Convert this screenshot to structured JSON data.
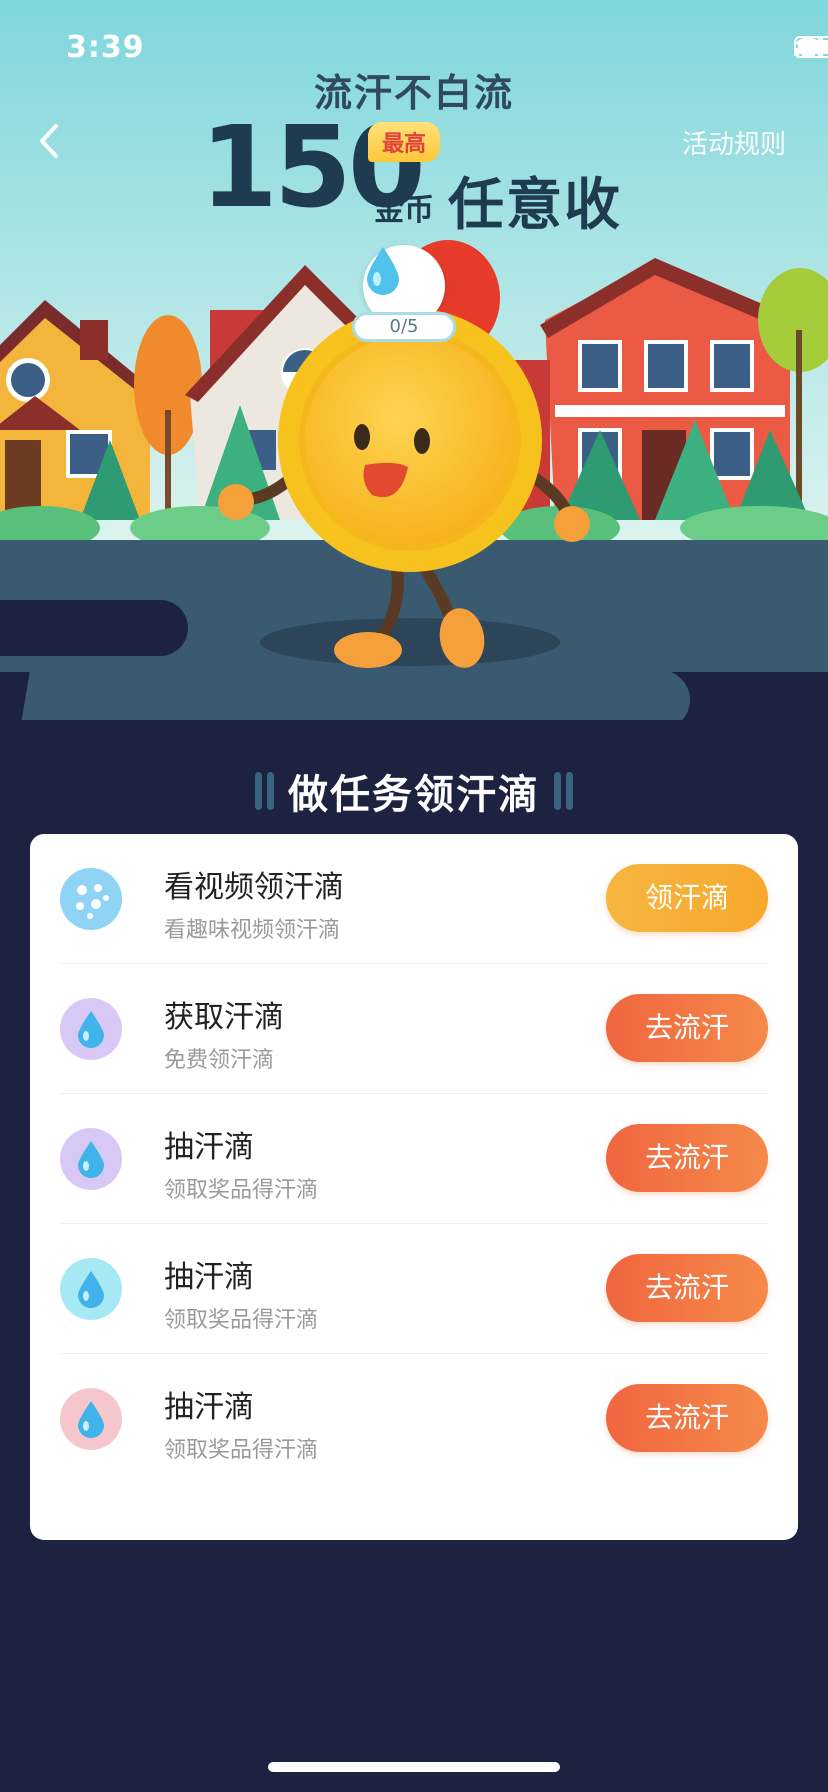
{
  "status_bar": {
    "time": "3:39"
  },
  "header": {
    "back_label": "‹",
    "rules_link": "活动规则",
    "headline_top": "流汗不白流",
    "big_number": "150",
    "badge_max": "最高",
    "unit": "金币",
    "tagline": "任意收"
  },
  "drop_meter": {
    "progress_text": "0/5",
    "collected": 0,
    "total": 5
  },
  "section": {
    "title": "做任务领汗滴"
  },
  "tasks": [
    {
      "icon": "video-dots-icon",
      "icon_bg": "#8fd3f5",
      "title": "看视频领汗滴",
      "subtitle": "看趣味视频领汗滴",
      "button": "领汗滴",
      "button_style": "yellow"
    },
    {
      "icon": "water-drop-icon",
      "icon_bg": "#d7c8f5",
      "title": "获取汗滴",
      "subtitle": "免费领汗滴",
      "button": "去流汗",
      "button_style": "orange"
    },
    {
      "icon": "water-drop-icon",
      "icon_bg": "#d7c8f5",
      "title": "抽汗滴",
      "subtitle": "领取奖品得汗滴",
      "button": "去流汗",
      "button_style": "orange"
    },
    {
      "icon": "water-drop-icon",
      "icon_bg": "#a7e8f5",
      "title": "抽汗滴",
      "subtitle": "领取奖品得汗滴",
      "button": "去流汗",
      "button_style": "orange"
    },
    {
      "icon": "water-drop-icon",
      "icon_bg": "#f5c7cc",
      "title": "抽汗滴",
      "subtitle": "领取奖品得汗滴",
      "button": "去流汗",
      "button_style": "orange"
    }
  ],
  "colors": {
    "page_bg": "#1c2240",
    "sky_top": "#7fd6dc",
    "road": "#3a5a72",
    "button_yellow": "#f5b640",
    "button_orange": "#f0653f",
    "headline_text": "#1f3b4f"
  }
}
